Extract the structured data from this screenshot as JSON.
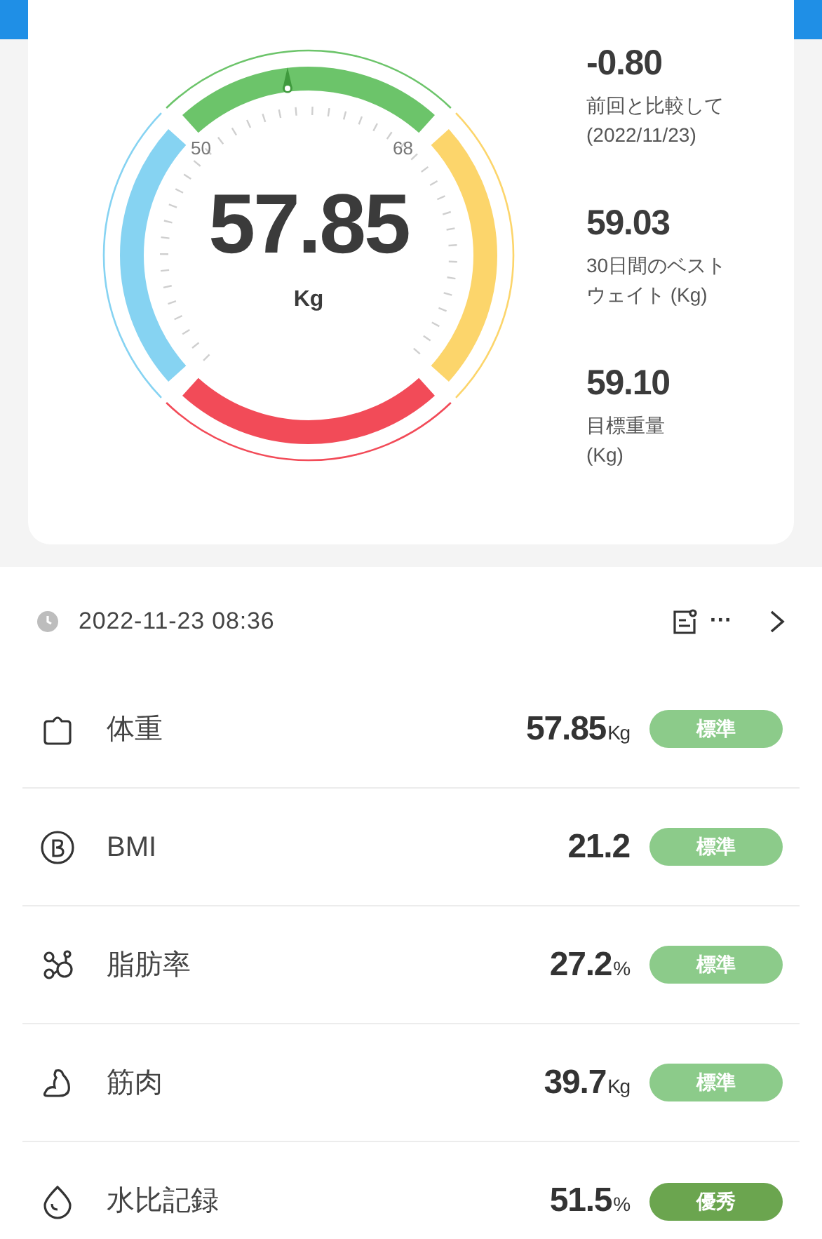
{
  "gauge": {
    "value": "57.85",
    "unit": "Kg",
    "min_label": "50",
    "max_label": "68"
  },
  "stats": [
    {
      "value": "-0.80",
      "label_lines": [
        "前回と比較して",
        "(2022/11/23)"
      ]
    },
    {
      "value": "59.03",
      "label_lines": [
        "30日間のベスト",
        "ウェイト (Kg)"
      ]
    },
    {
      "value": "59.10",
      "label_lines": [
        "目標重量",
        "(Kg)"
      ]
    }
  ],
  "record": {
    "datetime": "2022-11-23 08:36",
    "more": "···"
  },
  "metrics": [
    {
      "kind": "weight",
      "name": "体重",
      "value": "57.85",
      "unit": "Kg",
      "status": "標準",
      "color": "#8ccb8a"
    },
    {
      "kind": "bmi",
      "name": "BMI",
      "value": "21.2",
      "status": "標準",
      "color": "#8ccb8a"
    },
    {
      "kind": "fat",
      "name": "脂肪率",
      "value": "27.2",
      "unit": "%",
      "status": "標準",
      "color": "#8ccb8a"
    },
    {
      "kind": "muscle",
      "name": "筋肉",
      "value": "39.7",
      "unit": "Kg",
      "status": "標準",
      "color": "#8ccb8a"
    },
    {
      "kind": "water",
      "name": "水比記録",
      "value": "51.5",
      "unit": "%",
      "status": "優秀",
      "color": "#6ba54f"
    }
  ]
}
